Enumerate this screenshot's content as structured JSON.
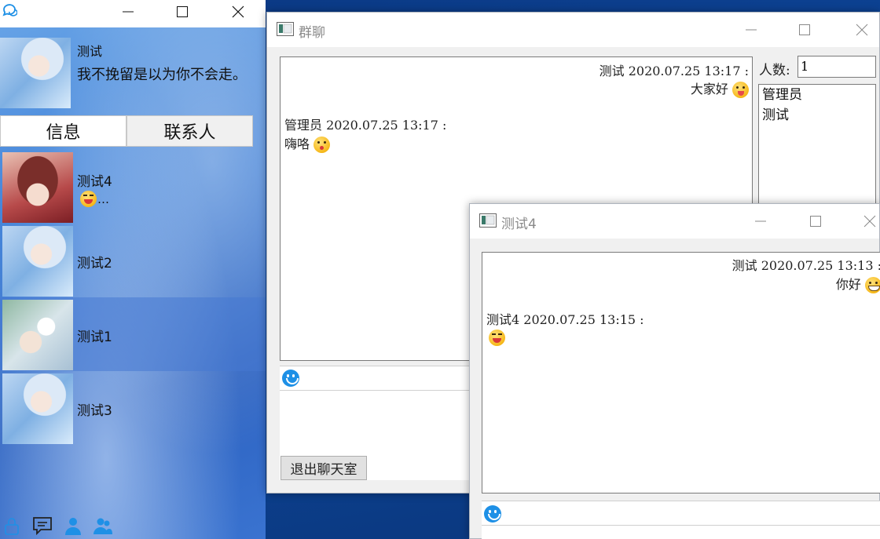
{
  "qq": {
    "profile": {
      "name": "测试",
      "signature": "我不挽留是以为你不会走。"
    },
    "tabs": [
      {
        "label": "信息"
      },
      {
        "label": "联系人"
      }
    ],
    "contacts": [
      {
        "name": "测试4",
        "preview": "…",
        "preview_icon": "xd-emoji-icon"
      },
      {
        "name": "测试2"
      },
      {
        "name": "测试1"
      },
      {
        "name": "测试3"
      }
    ]
  },
  "group_chat": {
    "title": "群聊",
    "messages": [
      {
        "header": "测试 2020.07.25 13:17 :",
        "text": "大家好",
        "emoji": "tongue-emoji-icon",
        "align": "right"
      },
      {
        "header": "管理员 2020.07.25 13:17 :",
        "text": "嗨咯",
        "emoji": "kiss-emoji-icon",
        "align": "left"
      }
    ],
    "member_count_label": "人数:",
    "member_count": "1",
    "members": [
      "管理员",
      "测试"
    ],
    "exit_button": "退出聊天室"
  },
  "private_chat": {
    "title": "测试4",
    "messages": [
      {
        "header": "测试 2020.07.25 13:13 :",
        "text": "你好",
        "emoji": "grin-emoji-icon",
        "align": "right"
      },
      {
        "header": "测试4 2020.07.25 13:15 :",
        "text": "",
        "emoji": "xd-emoji-icon",
        "align": "left"
      }
    ]
  },
  "colors": {
    "accent": "#1e90e6",
    "titlebar_text": "#8a8a8a",
    "selected_row": "#4678d2"
  }
}
